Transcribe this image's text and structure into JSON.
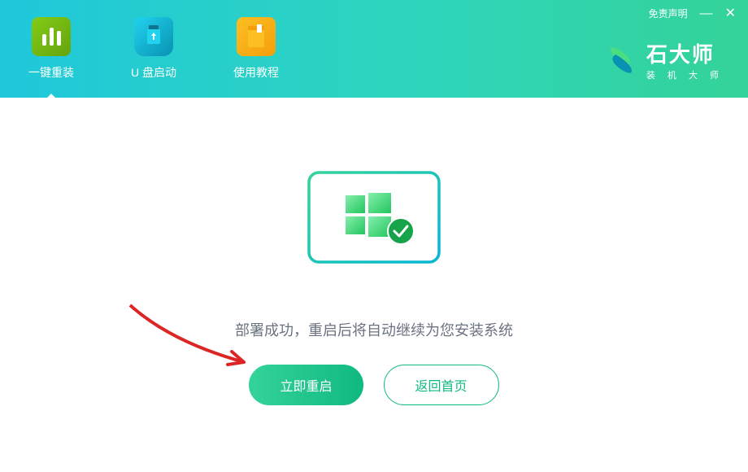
{
  "header": {
    "tabs": [
      {
        "label": "一键重装"
      },
      {
        "label": "U 盘启动"
      },
      {
        "label": "使用教程"
      }
    ],
    "disclaimer": "免责声明",
    "brand": {
      "title": "石大师",
      "subtitle": "装 机 大 师"
    }
  },
  "main": {
    "status_text": "部署成功，重启后将自动继续为您安装系统",
    "restart_button": "立即重启",
    "home_button": "返回首页"
  }
}
